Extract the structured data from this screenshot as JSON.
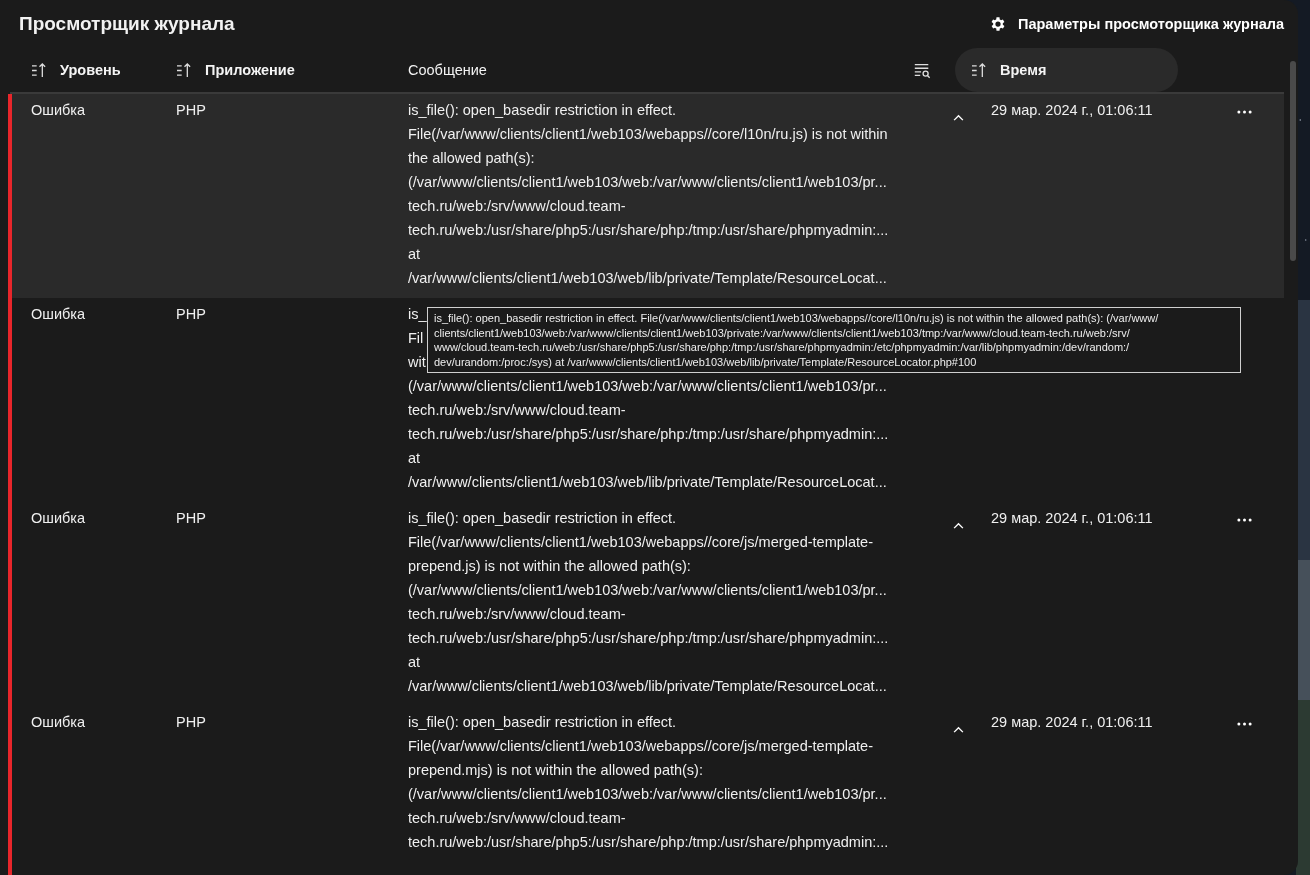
{
  "title": "Просмотрщик журнала",
  "settings_button": "Параметры просмоторщика журнала",
  "columns": [
    {
      "label": "Уровень",
      "sortable": true,
      "selected": false,
      "bold": true
    },
    {
      "label": "Приложение",
      "sortable": true,
      "selected": false,
      "bold": true
    },
    {
      "label": "Сообщение",
      "sortable": false,
      "selected": false,
      "bold": false
    },
    {
      "label": "Время",
      "sortable": true,
      "selected": true,
      "bold": true
    }
  ],
  "rows": [
    {
      "level": "Ошибка",
      "color": "#e8262b",
      "app": "PHP",
      "selected": true,
      "time": "29 мар. 2024 г., 01:06:11",
      "message": [
        "is_file(): open_basedir restriction in effect.",
        "File(/var/www/clients/client1/web103/webapps//core/l10n/ru.js) is not within",
        "the allowed path(s):",
        "(/var/www/clients/client1/web103/web:/var/www/clients/client1/web103/pr...",
        "tech.ru/web:/srv/www/cloud.team-",
        "tech.ru/web:/usr/share/php5:/usr/share/php:/tmp:/usr/share/phpmyadmin:...",
        "at",
        "/var/www/clients/client1/web103/web/lib/private/Template/ResourceLocat..."
      ]
    },
    {
      "level": "Ошибка",
      "color": "#e8262b",
      "app": "PHP",
      "selected": false,
      "message": [
        "is_",
        "Fil",
        "wit",
        "(/var/www/clients/client1/web103/web:/var/www/clients/client1/web103/pr...",
        "tech.ru/web:/srv/www/cloud.team-",
        "tech.ru/web:/usr/share/php5:/usr/share/php:/tmp:/usr/share/phpmyadmin:...",
        "at",
        "/var/www/clients/client1/web103/web/lib/private/Template/ResourceLocat..."
      ]
    },
    {
      "level": "Ошибка",
      "color": "#e8262b",
      "app": "PHP",
      "selected": false,
      "time": "29 мар. 2024 г., 01:06:11",
      "message": [
        "is_file(): open_basedir restriction in effect.",
        "File(/var/www/clients/client1/web103/webapps//core/js/merged-template-",
        "prepend.js) is not within the allowed path(s):",
        "(/var/www/clients/client1/web103/web:/var/www/clients/client1/web103/pr...",
        "tech.ru/web:/srv/www/cloud.team-",
        "tech.ru/web:/usr/share/php5:/usr/share/php:/tmp:/usr/share/phpmyadmin:...",
        "at",
        "/var/www/clients/client1/web103/web/lib/private/Template/ResourceLocat..."
      ]
    },
    {
      "level": "Ошибка",
      "color": "#e8262b",
      "app": "PHP",
      "selected": false,
      "time": "29 мар. 2024 г., 01:06:11",
      "message": [
        "is_file(): open_basedir restriction in effect.",
        "File(/var/www/clients/client1/web103/webapps//core/js/merged-template-",
        "prepend.mjs) is not within the allowed path(s):",
        "(/var/www/clients/client1/web103/web:/var/www/clients/client1/web103/pr...",
        "tech.ru/web:/srv/www/cloud.team-",
        "tech.ru/web:/usr/share/php5:/usr/share/php:/tmp:/usr/share/phpmyadmin:..."
      ]
    }
  ],
  "tooltip": {
    "lines": [
      "is_file(): open_basedir restriction in effect. File(/var/www/clients/client1/web103/webapps//core/l10n/ru.js) is not within the allowed path(s): (/var/www/",
      "clients/client1/web103/web:/var/www/clients/client1/web103/private:/var/www/clients/client1/web103/tmp:/var/www/cloud.team-tech.ru/web:/srv/",
      "www/cloud.team-tech.ru/web:/usr/share/php5:/usr/share/php:/tmp:/usr/share/phpmyadmin:/etc/phpmyadmin:/var/lib/phpmyadmin:/dev/random:/",
      "dev/urandom:/proc:/sys) at /var/www/clients/client1/web103/web/lib/private/Template/ResourceLocator.php#100"
    ]
  }
}
